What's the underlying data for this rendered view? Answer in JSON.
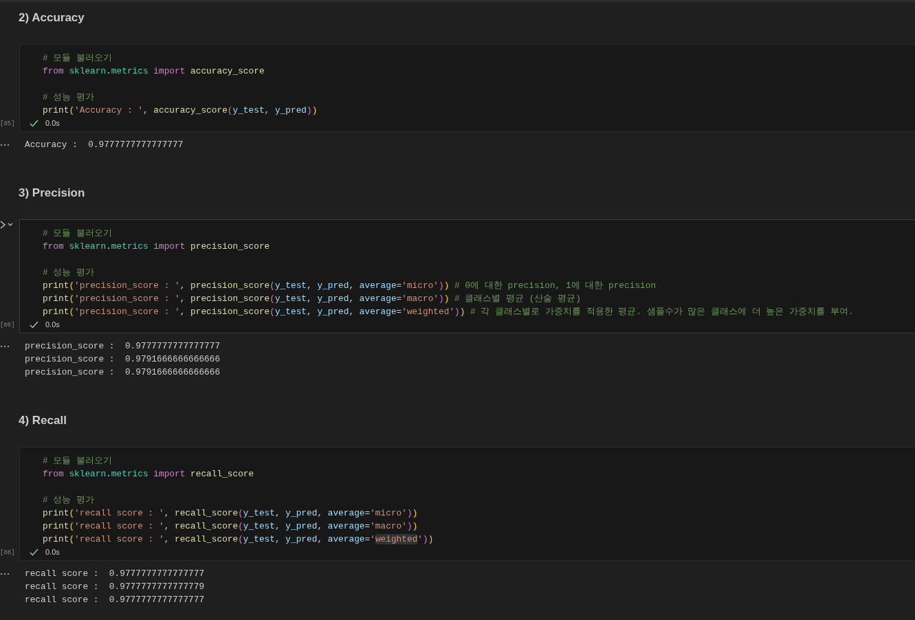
{
  "cells": [
    {
      "kind": "heading",
      "text": "2) Accuracy"
    },
    {
      "kind": "code",
      "count": "[85]",
      "focused": false,
      "success": true,
      "duration": "0.0s",
      "lines": [
        {
          "kind": "code",
          "tokens": [
            {
              "kind": "comment",
              "text": "# 모듈 불러오기"
            }
          ]
        },
        {
          "kind": "code",
          "tokens": [
            {
              "kind": "keyword",
              "text": "from "
            },
            {
              "kind": "module",
              "text": "sklearn"
            },
            {
              "kind": "plain",
              "text": "."
            },
            {
              "kind": "module",
              "text": "metrics "
            },
            {
              "kind": "keyword",
              "text": "import "
            },
            {
              "kind": "func",
              "text": "accuracy_score"
            }
          ]
        },
        {
          "kind": "blank"
        },
        {
          "kind": "code",
          "tokens": [
            {
              "kind": "comment",
              "text": "# 성능 평가"
            }
          ]
        },
        {
          "kind": "code",
          "tokens": [
            {
              "kind": "func",
              "text": "print"
            },
            {
              "kind": "paren",
              "text": "("
            },
            {
              "kind": "string",
              "text": "'Accuracy : '"
            },
            {
              "kind": "plain",
              "text": ", "
            },
            {
              "kind": "func",
              "text": "accuracy_score"
            },
            {
              "kind": "paren2",
              "text": "("
            },
            {
              "kind": "var",
              "text": "y_test"
            },
            {
              "kind": "plain",
              "text": ", "
            },
            {
              "kind": "var",
              "text": "y_pred"
            },
            {
              "kind": "paren2",
              "text": ")"
            },
            {
              "kind": "paren",
              "text": ")"
            }
          ]
        }
      ],
      "output": [
        "Accuracy :  0.9777777777777777"
      ]
    },
    {
      "kind": "heading",
      "text": "3) Precision"
    },
    {
      "kind": "code",
      "count": "[86]",
      "focused": true,
      "success": true,
      "duration": "0.0s",
      "lines": [
        {
          "kind": "code",
          "tokens": [
            {
              "kind": "comment",
              "text": "# 모듈 불러오기"
            }
          ]
        },
        {
          "kind": "code",
          "tokens": [
            {
              "kind": "keyword",
              "text": "from "
            },
            {
              "kind": "module",
              "text": "sklearn"
            },
            {
              "kind": "plain",
              "text": "."
            },
            {
              "kind": "module",
              "text": "metrics "
            },
            {
              "kind": "keyword",
              "text": "import "
            },
            {
              "kind": "func",
              "text": "precision_score"
            }
          ]
        },
        {
          "kind": "blank"
        },
        {
          "kind": "code",
          "tokens": [
            {
              "kind": "comment",
              "text": "# 성능 평가"
            }
          ]
        },
        {
          "kind": "code",
          "tokens": [
            {
              "kind": "func",
              "text": "print"
            },
            {
              "kind": "paren",
              "text": "("
            },
            {
              "kind": "string",
              "text": "'precision_score : '"
            },
            {
              "kind": "plain",
              "text": ", "
            },
            {
              "kind": "func",
              "text": "precision_score"
            },
            {
              "kind": "paren2",
              "text": "("
            },
            {
              "kind": "var",
              "text": "y_test"
            },
            {
              "kind": "plain",
              "text": ", "
            },
            {
              "kind": "var",
              "text": "y_pred"
            },
            {
              "kind": "plain",
              "text": ", "
            },
            {
              "kind": "var",
              "text": "average"
            },
            {
              "kind": "plain",
              "text": "="
            },
            {
              "kind": "string",
              "text": "'micro'"
            },
            {
              "kind": "paren2",
              "text": ")"
            },
            {
              "kind": "paren",
              "text": ")"
            },
            {
              "kind": "comment",
              "text": " # 0에 대한 precision, 1에 대한 precision"
            }
          ]
        },
        {
          "kind": "code",
          "tokens": [
            {
              "kind": "func",
              "text": "print"
            },
            {
              "kind": "paren",
              "text": "("
            },
            {
              "kind": "string",
              "text": "'precision_score : '"
            },
            {
              "kind": "plain",
              "text": ", "
            },
            {
              "kind": "func",
              "text": "precision_score"
            },
            {
              "kind": "paren2",
              "text": "("
            },
            {
              "kind": "var",
              "text": "y_test"
            },
            {
              "kind": "plain",
              "text": ", "
            },
            {
              "kind": "var",
              "text": "y_pred"
            },
            {
              "kind": "plain",
              "text": ", "
            },
            {
              "kind": "var",
              "text": "average"
            },
            {
              "kind": "plain",
              "text": "="
            },
            {
              "kind": "string",
              "text": "'macro'"
            },
            {
              "kind": "paren2",
              "text": ")"
            },
            {
              "kind": "paren",
              "text": ")"
            },
            {
              "kind": "comment",
              "text": " # 클래스별 평균 (산술 평균)"
            }
          ]
        },
        {
          "kind": "code",
          "tokens": [
            {
              "kind": "func",
              "text": "print"
            },
            {
              "kind": "paren",
              "text": "("
            },
            {
              "kind": "string",
              "text": "'precision_score : '"
            },
            {
              "kind": "plain",
              "text": ", "
            },
            {
              "kind": "func",
              "text": "precision_score"
            },
            {
              "kind": "paren2",
              "text": "("
            },
            {
              "kind": "var",
              "text": "y_test"
            },
            {
              "kind": "plain",
              "text": ", "
            },
            {
              "kind": "var",
              "text": "y_pred"
            },
            {
              "kind": "plain",
              "text": ", "
            },
            {
              "kind": "var",
              "text": "average"
            },
            {
              "kind": "plain",
              "text": "="
            },
            {
              "kind": "string",
              "text": "'weighted'"
            },
            {
              "kind": "paren2",
              "text": ")"
            },
            {
              "kind": "paren",
              "text": ")"
            },
            {
              "kind": "comment",
              "text": " # 각 클래스별로 가중치를 적용한 평균. 샘플수가 많은 클래스에 더 높은 가중치를 부여."
            }
          ]
        }
      ],
      "output": [
        "precision_score :  0.9777777777777777",
        "precision_score :  0.9791666666666666",
        "precision_score :  0.9791666666666666"
      ]
    },
    {
      "kind": "heading",
      "text": "4) Recall"
    },
    {
      "kind": "code",
      "count": "[88]",
      "focused": false,
      "success": true,
      "duration": "0.0s",
      "lines": [
        {
          "kind": "code",
          "tokens": [
            {
              "kind": "comment",
              "text": "# 모듈 불러오기"
            }
          ]
        },
        {
          "kind": "code",
          "tokens": [
            {
              "kind": "keyword",
              "text": "from "
            },
            {
              "kind": "module",
              "text": "sklearn"
            },
            {
              "kind": "plain",
              "text": "."
            },
            {
              "kind": "module",
              "text": "metrics "
            },
            {
              "kind": "keyword",
              "text": "import "
            },
            {
              "kind": "func",
              "text": "recall_score"
            }
          ]
        },
        {
          "kind": "blank"
        },
        {
          "kind": "code",
          "tokens": [
            {
              "kind": "comment",
              "text": "# 성능 평가"
            }
          ]
        },
        {
          "kind": "code",
          "tokens": [
            {
              "kind": "func",
              "text": "print"
            },
            {
              "kind": "paren",
              "text": "("
            },
            {
              "kind": "string",
              "text": "'recall score : '"
            },
            {
              "kind": "plain",
              "text": ", "
            },
            {
              "kind": "func",
              "text": "recall_score"
            },
            {
              "kind": "paren2",
              "text": "("
            },
            {
              "kind": "var",
              "text": "y_test"
            },
            {
              "kind": "plain",
              "text": ", "
            },
            {
              "kind": "var",
              "text": "y_pred"
            },
            {
              "kind": "plain",
              "text": ", "
            },
            {
              "kind": "var",
              "text": "average"
            },
            {
              "kind": "plain",
              "text": "="
            },
            {
              "kind": "string",
              "text": "'micro'"
            },
            {
              "kind": "paren2",
              "text": ")"
            },
            {
              "kind": "paren",
              "text": ")"
            }
          ]
        },
        {
          "kind": "code",
          "tokens": [
            {
              "kind": "func",
              "text": "print"
            },
            {
              "kind": "paren",
              "text": "("
            },
            {
              "kind": "string",
              "text": "'recall score : '"
            },
            {
              "kind": "plain",
              "text": ", "
            },
            {
              "kind": "func",
              "text": "recall_score"
            },
            {
              "kind": "paren2",
              "text": "("
            },
            {
              "kind": "var",
              "text": "y_test"
            },
            {
              "kind": "plain",
              "text": ", "
            },
            {
              "kind": "var",
              "text": "y_pred"
            },
            {
              "kind": "plain",
              "text": ", "
            },
            {
              "kind": "var",
              "text": "average"
            },
            {
              "kind": "plain",
              "text": "="
            },
            {
              "kind": "string",
              "text": "'macro'"
            },
            {
              "kind": "paren2",
              "text": ")"
            },
            {
              "kind": "paren",
              "text": ")"
            }
          ]
        },
        {
          "kind": "code",
          "tokens": [
            {
              "kind": "func",
              "text": "print"
            },
            {
              "kind": "paren",
              "text": "("
            },
            {
              "kind": "string",
              "text": "'recall score : '"
            },
            {
              "kind": "plain",
              "text": ", "
            },
            {
              "kind": "func",
              "text": "recall_score"
            },
            {
              "kind": "paren2",
              "text": "("
            },
            {
              "kind": "var",
              "text": "y_test"
            },
            {
              "kind": "plain",
              "text": ", "
            },
            {
              "kind": "var",
              "text": "y_pred"
            },
            {
              "kind": "plain",
              "text": ", "
            },
            {
              "kind": "var",
              "text": "average"
            },
            {
              "kind": "plain",
              "text": "="
            },
            {
              "kind": "string",
              "text": "'"
            },
            {
              "kind": "string",
              "text": "weighted",
              "highlighted": true
            },
            {
              "kind": "string",
              "text": "'"
            },
            {
              "kind": "paren2",
              "text": ")"
            },
            {
              "kind": "paren",
              "text": ")"
            }
          ]
        }
      ],
      "output": [
        "recall score :  0.9777777777777777",
        "recall score :  0.9777777777777779",
        "recall score :  0.9777777777777777"
      ]
    }
  ]
}
